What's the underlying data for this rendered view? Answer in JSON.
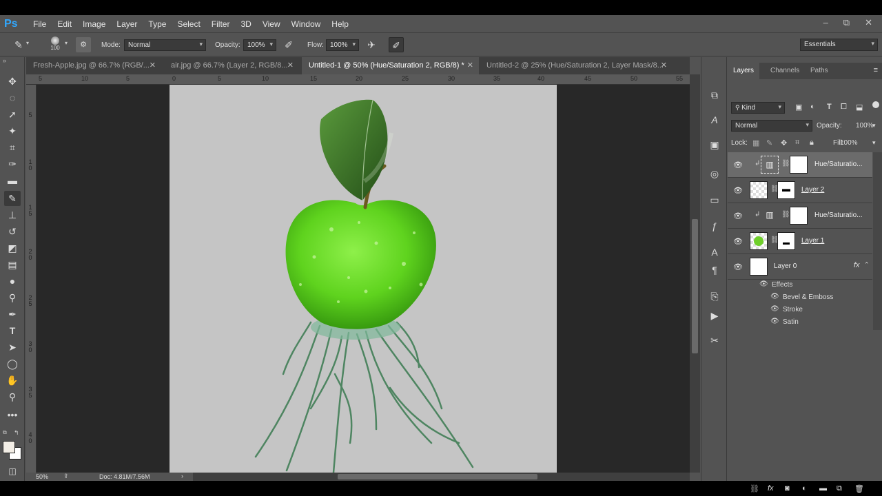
{
  "app": {
    "logo": "Ps"
  },
  "menu": [
    "File",
    "Edit",
    "Image",
    "Layer",
    "Type",
    "Select",
    "Filter",
    "3D",
    "View",
    "Window",
    "Help"
  ],
  "window_controls": {
    "minimize": "–",
    "restore": "⧉",
    "close": "✕"
  },
  "options": {
    "brush_size": "100",
    "mode_label": "Mode:",
    "mode_value": "Normal",
    "opacity_label": "Opacity:",
    "opacity_value": "100%",
    "flow_label": "Flow:",
    "flow_value": "100%",
    "workspace": "Essentials"
  },
  "tabs": [
    {
      "label": "Fresh-Apple.jpg @ 66.7% (RGB/...",
      "close": "✕"
    },
    {
      "label": "air.jpg @ 66.7% (Layer 2, RGB/8...",
      "close": "✕"
    },
    {
      "label": "Untitled-1 @ 50% (Hue/Saturation 2, RGB/8) *",
      "close": "✕"
    },
    {
      "label": "Untitled-2 @ 25% (Hue/Saturation 2, Layer Mask/8...",
      "close": "✕"
    }
  ],
  "ruler_top": [
    "5",
    "10",
    "5",
    "0",
    "5",
    "10",
    "15",
    "20",
    "25",
    "30",
    "35",
    "40",
    "45",
    "50",
    "55"
  ],
  "ruler_left": [
    "5",
    "1\n0",
    "1\n5",
    "2\n0",
    "2\n5",
    "3\n0",
    "3\n5",
    "4\n0"
  ],
  "status": {
    "zoom": "50%",
    "doc": "Doc: 4.81M/7.56M"
  },
  "panel": {
    "tabs": [
      "Layers",
      "Channels",
      "Paths"
    ],
    "kind": "Kind",
    "blend_mode": "Normal",
    "opacity_label": "Opacity:",
    "opacity_value": "100%",
    "lock_label": "Lock:",
    "fill_label": "Fill:",
    "fill_value": "100%",
    "layers": [
      {
        "name": "Hue/Saturatio...",
        "type": "adjustment",
        "selected": true
      },
      {
        "name": "Layer 2",
        "type": "pixel-splash"
      },
      {
        "name": "Hue/Saturatio...",
        "type": "adjustment"
      },
      {
        "name": "Layer 1",
        "type": "pixel-apple"
      },
      {
        "name": "Layer 0",
        "type": "base",
        "fx": "fx"
      }
    ],
    "effects_label": "Effects",
    "effects": [
      "Bevel & Emboss",
      "Stroke",
      "Satin"
    ]
  },
  "colors": {
    "apple_green": "#5fd31e",
    "leaf": "#3f7a2c",
    "canvas_bg": "#c5c5c5"
  }
}
